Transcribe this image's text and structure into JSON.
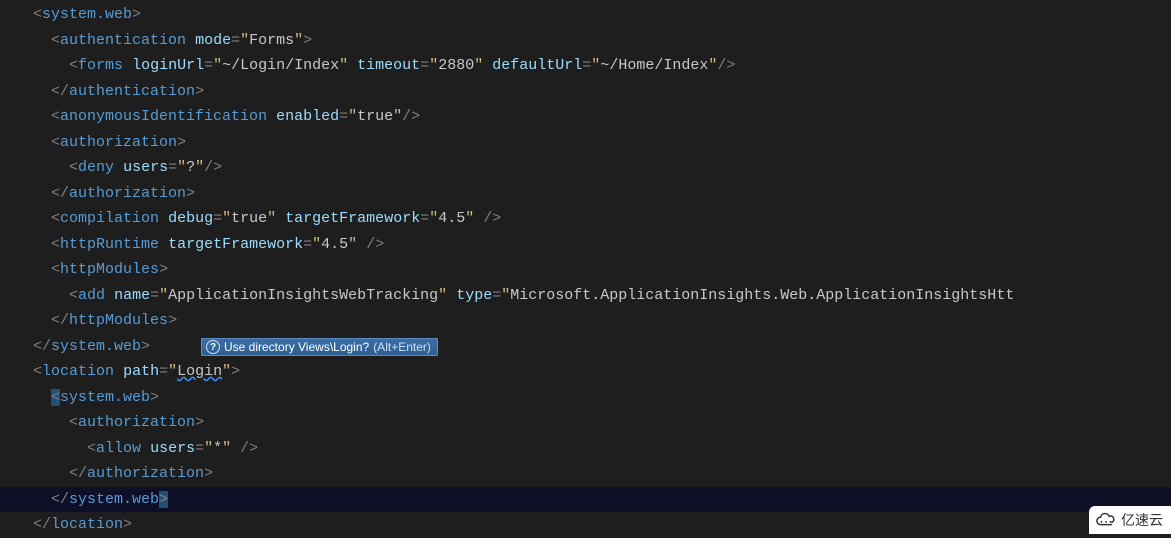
{
  "code": {
    "lines": [
      {
        "indent": 1,
        "tokens": [
          {
            "t": "punct",
            "v": "<"
          },
          {
            "t": "tag",
            "v": "system.web"
          },
          {
            "t": "punct",
            "v": ">"
          }
        ]
      },
      {
        "indent": 2,
        "tokens": [
          {
            "t": "punct",
            "v": "<"
          },
          {
            "t": "tag",
            "v": "authentication"
          },
          {
            "t": "plain",
            "v": " "
          },
          {
            "t": "attr",
            "v": "mode"
          },
          {
            "t": "eq",
            "v": "="
          },
          {
            "t": "str",
            "v": "\""
          },
          {
            "t": "val",
            "v": "Forms"
          },
          {
            "t": "str",
            "v": "\""
          },
          {
            "t": "punct",
            "v": ">"
          }
        ]
      },
      {
        "indent": 3,
        "tokens": [
          {
            "t": "punct",
            "v": "<"
          },
          {
            "t": "tag",
            "v": "forms"
          },
          {
            "t": "plain",
            "v": " "
          },
          {
            "t": "attr",
            "v": "loginUrl"
          },
          {
            "t": "eq",
            "v": "="
          },
          {
            "t": "str",
            "v": "\""
          },
          {
            "t": "val",
            "v": "~/Login/Index"
          },
          {
            "t": "str",
            "v": "\""
          },
          {
            "t": "plain",
            "v": " "
          },
          {
            "t": "attr",
            "v": "timeout"
          },
          {
            "t": "eq",
            "v": "="
          },
          {
            "t": "str",
            "v": "\""
          },
          {
            "t": "val",
            "v": "2880"
          },
          {
            "t": "str",
            "v": "\""
          },
          {
            "t": "plain",
            "v": " "
          },
          {
            "t": "attr",
            "v": "defaultUrl"
          },
          {
            "t": "eq",
            "v": "="
          },
          {
            "t": "str",
            "v": "\""
          },
          {
            "t": "val",
            "v": "~/Home/Index"
          },
          {
            "t": "str",
            "v": "\""
          },
          {
            "t": "punct",
            "v": "/>"
          }
        ]
      },
      {
        "indent": 2,
        "tokens": [
          {
            "t": "punct",
            "v": "</"
          },
          {
            "t": "tag",
            "v": "authentication"
          },
          {
            "t": "punct",
            "v": ">"
          }
        ]
      },
      {
        "indent": 2,
        "tokens": [
          {
            "t": "punct",
            "v": "<"
          },
          {
            "t": "tag",
            "v": "anonymousIdentification"
          },
          {
            "t": "plain",
            "v": " "
          },
          {
            "t": "attr",
            "v": "enabled"
          },
          {
            "t": "eq",
            "v": "="
          },
          {
            "t": "str",
            "v": "\""
          },
          {
            "t": "val",
            "v": "true"
          },
          {
            "t": "str",
            "v": "\""
          },
          {
            "t": "punct",
            "v": "/>"
          }
        ]
      },
      {
        "indent": 2,
        "tokens": [
          {
            "t": "punct",
            "v": "<"
          },
          {
            "t": "tag",
            "v": "authorization"
          },
          {
            "t": "punct",
            "v": ">"
          }
        ]
      },
      {
        "indent": 3,
        "tokens": [
          {
            "t": "punct",
            "v": "<"
          },
          {
            "t": "tag",
            "v": "deny"
          },
          {
            "t": "plain",
            "v": " "
          },
          {
            "t": "attr",
            "v": "users"
          },
          {
            "t": "eq",
            "v": "="
          },
          {
            "t": "str",
            "v": "\""
          },
          {
            "t": "val",
            "v": "?"
          },
          {
            "t": "str",
            "v": "\""
          },
          {
            "t": "punct",
            "v": "/>"
          }
        ]
      },
      {
        "indent": 2,
        "tokens": [
          {
            "t": "punct",
            "v": "</"
          },
          {
            "t": "tag",
            "v": "authorization"
          },
          {
            "t": "punct",
            "v": ">"
          }
        ]
      },
      {
        "indent": 2,
        "tokens": [
          {
            "t": "punct",
            "v": "<"
          },
          {
            "t": "tag",
            "v": "compilation"
          },
          {
            "t": "plain",
            "v": " "
          },
          {
            "t": "attr",
            "v": "debug"
          },
          {
            "t": "eq",
            "v": "="
          },
          {
            "t": "str",
            "v": "\""
          },
          {
            "t": "val",
            "v": "true"
          },
          {
            "t": "str",
            "v": "\""
          },
          {
            "t": "plain",
            "v": " "
          },
          {
            "t": "attr",
            "v": "targetFramework"
          },
          {
            "t": "eq",
            "v": "="
          },
          {
            "t": "str",
            "v": "\""
          },
          {
            "t": "val",
            "v": "4.5"
          },
          {
            "t": "str",
            "v": "\""
          },
          {
            "t": "plain",
            "v": " "
          },
          {
            "t": "punct",
            "v": "/>"
          }
        ]
      },
      {
        "indent": 2,
        "tokens": [
          {
            "t": "punct",
            "v": "<"
          },
          {
            "t": "tag",
            "v": "httpRuntime"
          },
          {
            "t": "plain",
            "v": " "
          },
          {
            "t": "attr",
            "v": "targetFramework"
          },
          {
            "t": "eq",
            "v": "="
          },
          {
            "t": "str",
            "v": "\""
          },
          {
            "t": "val",
            "v": "4.5"
          },
          {
            "t": "str",
            "v": "\""
          },
          {
            "t": "plain",
            "v": " "
          },
          {
            "t": "punct",
            "v": "/>"
          }
        ]
      },
      {
        "indent": 2,
        "tokens": [
          {
            "t": "punct",
            "v": "<"
          },
          {
            "t": "tag",
            "v": "httpModules"
          },
          {
            "t": "punct",
            "v": ">"
          }
        ]
      },
      {
        "indent": 3,
        "tokens": [
          {
            "t": "punct",
            "v": "<"
          },
          {
            "t": "tag",
            "v": "add"
          },
          {
            "t": "plain",
            "v": " "
          },
          {
            "t": "attr",
            "v": "name"
          },
          {
            "t": "eq",
            "v": "="
          },
          {
            "t": "str",
            "v": "\""
          },
          {
            "t": "val",
            "v": "ApplicationInsightsWebTracking"
          },
          {
            "t": "str",
            "v": "\""
          },
          {
            "t": "plain",
            "v": " "
          },
          {
            "t": "attr",
            "v": "type"
          },
          {
            "t": "eq",
            "v": "="
          },
          {
            "t": "str",
            "v": "\""
          },
          {
            "t": "val",
            "v": "Microsoft.ApplicationInsights.Web.ApplicationInsightsHtt"
          }
        ]
      },
      {
        "indent": 2,
        "tokens": [
          {
            "t": "punct",
            "v": "</"
          },
          {
            "t": "tag",
            "v": "httpModules"
          },
          {
            "t": "punct",
            "v": ">"
          }
        ]
      },
      {
        "indent": 1,
        "tokens": [
          {
            "t": "punct",
            "v": "</"
          },
          {
            "t": "tag",
            "v": "system.web"
          },
          {
            "t": "punct",
            "v": ">"
          }
        ]
      },
      {
        "indent": 1,
        "tokens": [
          {
            "t": "punct",
            "v": "<"
          },
          {
            "t": "tag",
            "v": "location"
          },
          {
            "t": "plain",
            "v": " "
          },
          {
            "t": "attr",
            "v": "path"
          },
          {
            "t": "eq",
            "v": "="
          },
          {
            "t": "str",
            "v": "\""
          },
          {
            "t": "val underline",
            "v": "Login"
          },
          {
            "t": "str",
            "v": "\""
          },
          {
            "t": "punct",
            "v": ">"
          }
        ]
      },
      {
        "indent": 2,
        "tokens": [
          {
            "t": "punct highlight",
            "v": "<"
          },
          {
            "t": "tag",
            "v": "system.web"
          },
          {
            "t": "punct",
            "v": ">"
          }
        ]
      },
      {
        "indent": 3,
        "tokens": [
          {
            "t": "punct",
            "v": "<"
          },
          {
            "t": "tag",
            "v": "authorization"
          },
          {
            "t": "punct",
            "v": ">"
          }
        ]
      },
      {
        "indent": 4,
        "tokens": [
          {
            "t": "punct",
            "v": "<"
          },
          {
            "t": "tag",
            "v": "allow"
          },
          {
            "t": "plain",
            "v": " "
          },
          {
            "t": "attr",
            "v": "users"
          },
          {
            "t": "eq",
            "v": "="
          },
          {
            "t": "str",
            "v": "\""
          },
          {
            "t": "val",
            "v": "*"
          },
          {
            "t": "str",
            "v": "\""
          },
          {
            "t": "plain",
            "v": " "
          },
          {
            "t": "punct",
            "v": "/>"
          }
        ]
      },
      {
        "indent": 3,
        "tokens": [
          {
            "t": "punct",
            "v": "</"
          },
          {
            "t": "tag",
            "v": "authorization"
          },
          {
            "t": "punct",
            "v": ">"
          }
        ]
      },
      {
        "indent": 2,
        "current": true,
        "tokens": [
          {
            "t": "punct",
            "v": "</"
          },
          {
            "t": "tag",
            "v": "system.web"
          },
          {
            "t": "punct highlight",
            "v": ">"
          }
        ]
      },
      {
        "indent": 1,
        "tokens": [
          {
            "t": "punct",
            "v": "</"
          },
          {
            "t": "tag",
            "v": "location"
          },
          {
            "t": "punct",
            "v": ">"
          }
        ]
      }
    ]
  },
  "hint": {
    "text": "Use directory Views\\Login?",
    "shortcut": "(Alt+Enter)"
  },
  "watermark": "亿速云"
}
